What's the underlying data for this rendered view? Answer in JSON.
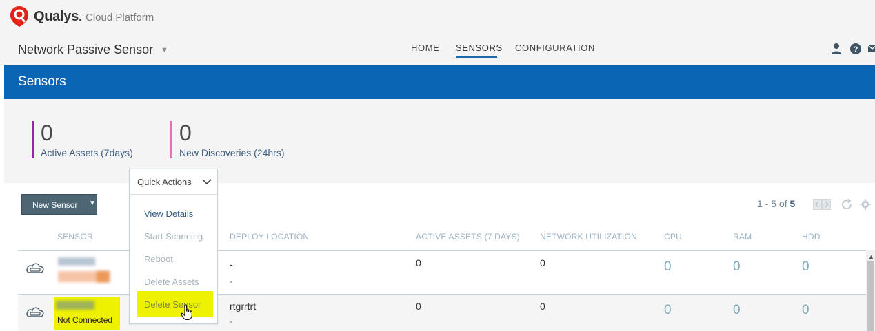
{
  "brand": {
    "name": "Qualys.",
    "product": "Cloud Platform",
    "logo_icon": "qualys-shield-logo"
  },
  "app": {
    "title": "Network Passive Sensor"
  },
  "nav": {
    "home": "HOME",
    "sensors": "SENSORS",
    "configuration": "CONFIGURATION",
    "active": "SENSORS"
  },
  "header_icons": [
    "user-icon",
    "help-icon",
    "mail-icon"
  ],
  "page": {
    "title": "Sensors"
  },
  "stats": {
    "active_assets": {
      "value": "0",
      "label": "Active Assets (7days)",
      "color": "#9b1fa8"
    },
    "new_discoveries": {
      "value": "0",
      "label": "New Discoveries (24hrs)",
      "color": "#e96fb6"
    }
  },
  "toolbar": {
    "new_sensor": "New Sensor",
    "pager": {
      "range": "1 - 5 of",
      "total": "5"
    }
  },
  "quick_actions": {
    "label": "Quick Actions",
    "items": [
      {
        "label": "View Details",
        "enabled": true
      },
      {
        "label": "Start Scanning",
        "enabled": false
      },
      {
        "label": "Reboot",
        "enabled": false
      },
      {
        "label": "Delete Assets",
        "enabled": false
      },
      {
        "label": "Delete Sensor",
        "enabled": false,
        "highlighted": true
      }
    ]
  },
  "table": {
    "columns": [
      "SENSOR",
      "DEPLOY LOCATION",
      "ACTIVE ASSETS (7 DAYS)",
      "NETWORK UTILIZATION",
      "CPU",
      "RAM",
      "HDD"
    ],
    "rows": [
      {
        "sensor_status": "",
        "deploy_location": "-",
        "deploy_sub": "-",
        "active_assets": "0",
        "network_utilization": "0",
        "cpu": "0",
        "ram": "0",
        "hdd": "0"
      },
      {
        "sensor_status": "Not Connected",
        "deploy_location": "rtgrrtrt",
        "deploy_sub": "-",
        "active_assets": "0",
        "network_utilization": "0",
        "cpu": "0",
        "ram": "0",
        "hdd": "0"
      }
    ]
  },
  "colors": {
    "brand_red": "#e2231a",
    "header_blue": "#0a66b5",
    "highlight": "#eef200"
  }
}
